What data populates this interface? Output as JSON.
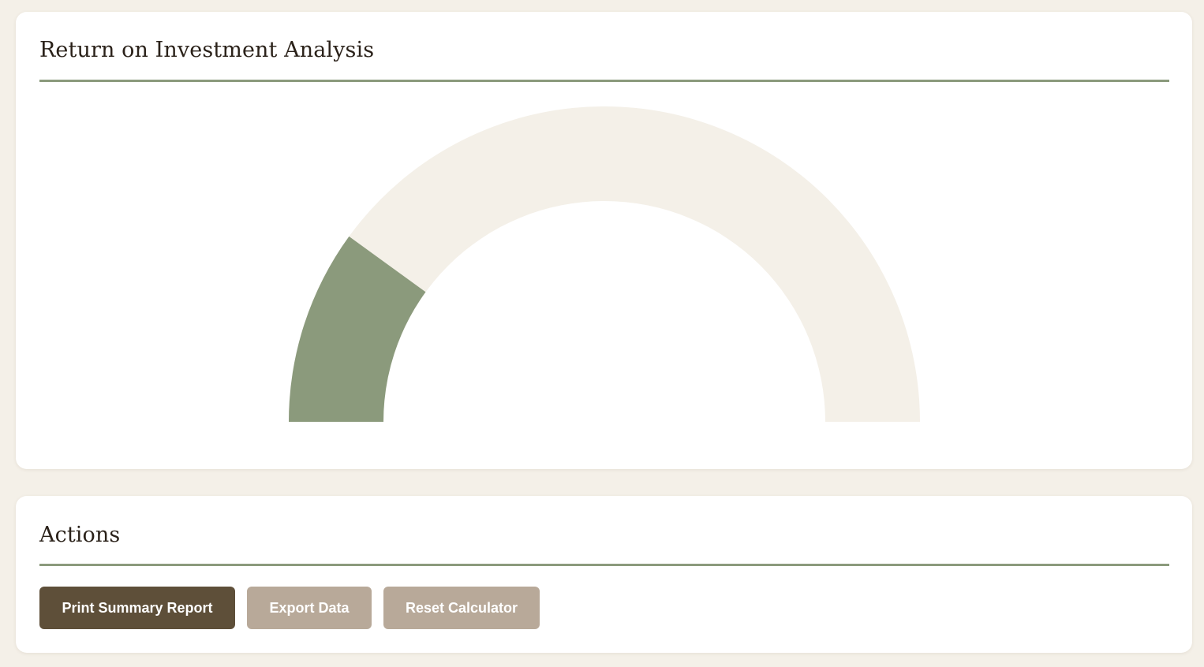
{
  "roi_card": {
    "title": "Return on Investment Analysis"
  },
  "chart_data": {
    "type": "gauge",
    "value_fraction": 0.2,
    "colors": {
      "fill": "#8b9a7c",
      "track": "#f4f0e8"
    }
  },
  "actions_card": {
    "title": "Actions",
    "buttons": [
      {
        "label": "Print Summary Report",
        "color": "#5e4f39"
      },
      {
        "label": "Export Data",
        "color": "#b8a999"
      },
      {
        "label": "Reset Calculator",
        "color": "#b8a999"
      }
    ]
  },
  "colors": {
    "page_background": "#f4f0e8",
    "card_background": "#ffffff",
    "accent_rule": "#8b9a7c",
    "heading_text": "#2a2119"
  }
}
